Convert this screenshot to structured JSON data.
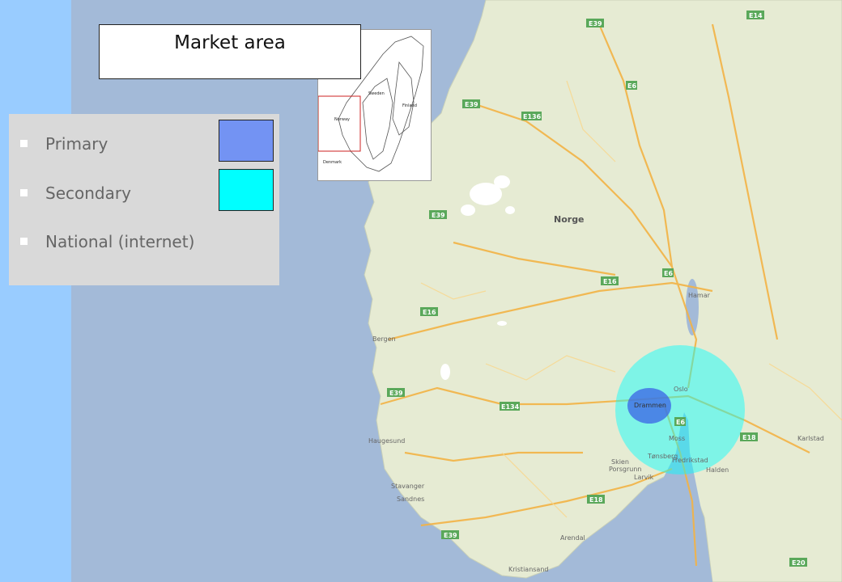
{
  "title": "Market area",
  "legend": {
    "items": [
      {
        "label": "Primary",
        "color": "#7393f3"
      },
      {
        "label": "Secondary",
        "color": "#00ffff"
      },
      {
        "label": "National (internet)",
        "color": ""
      }
    ]
  },
  "map": {
    "country_label": "Norge",
    "cities": [
      "Bergen",
      "Oslo",
      "Drammen",
      "Haugesund",
      "Stavanger",
      "Sandnes",
      "Kristiansand",
      "Arendal",
      "Larvik",
      "Skien",
      "Porsgrunn",
      "Tønsberg",
      "Fredrikstad",
      "Halden",
      "Moss",
      "Hamar",
      "Karlstad"
    ],
    "roads": [
      "E39",
      "E136",
      "E16",
      "E6",
      "E134",
      "E18",
      "E14",
      "E20"
    ],
    "water_color": "#a3bad8",
    "land_color": "#e8ecd6",
    "market_center": "Drammen"
  },
  "inset": {
    "labels": [
      "Norway",
      "Sweden",
      "Finland",
      "Denmark"
    ]
  }
}
